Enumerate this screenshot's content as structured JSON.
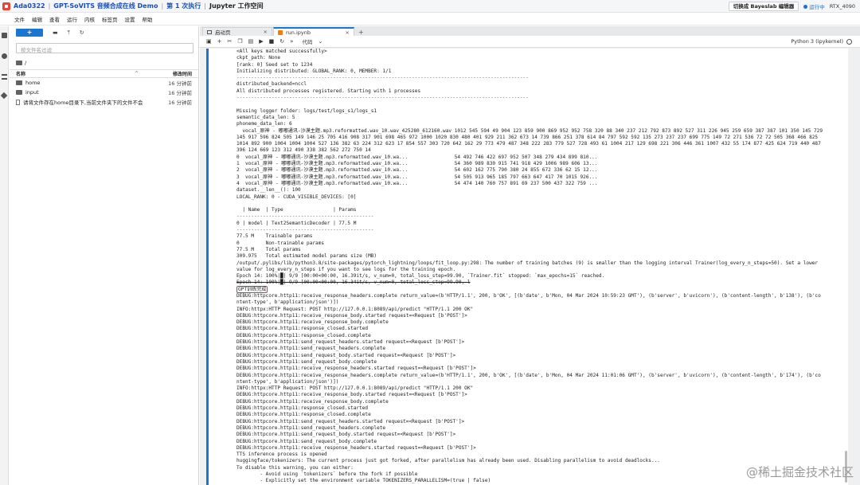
{
  "topbar": {
    "crumbs": [
      "Ada0322",
      "GPT-SoVITS 音频合成在线 Demo",
      "第 1 次执行",
      "Jupyter 工作空间"
    ],
    "switch_label": "切换成 Bayeslab 编辑器",
    "status": "运行中",
    "gpu": "RTX_4090"
  },
  "menu": [
    "文件",
    "编辑",
    "查看",
    "运行",
    "内核",
    "标签页",
    "设置",
    "帮助"
  ],
  "filebrowser": {
    "new_label": "+",
    "filter_placeholder": "按文件名过滤",
    "cwd": "/",
    "col_name": "名称",
    "col_modified": "修改时间",
    "files": [
      {
        "name": "home",
        "time": "16 分钟前",
        "type": "folder"
      },
      {
        "name": "input",
        "time": "16 分钟前",
        "type": "folder"
      },
      {
        "name": "请将文件存在home目录下,当前文件夹下的文件不会...",
        "time": "16 分钟前",
        "type": "file"
      }
    ]
  },
  "tabs": [
    {
      "label": "启动页"
    },
    {
      "label": "run.ipynb"
    }
  ],
  "notebook": {
    "cell_type": "代码",
    "kernel": "Python 3 (ipykernel)"
  },
  "log_lines": [
    {
      "t": "<All keys matched successfully>"
    },
    {
      "t": "ckpt_path: None"
    },
    {
      "t": "[rank: 0] Seed set to 1234"
    },
    {
      "t": "Initializing distributed: GLOBAL_RANK: 0, MEMBER: 1/1"
    },
    {
      "t": "----------------------------------------------------------------------------------------------------",
      "c": "rule"
    },
    {
      "t": "distributed_backend=nccl"
    },
    {
      "t": "All distributed processes registered. Starting with 1 processes"
    },
    {
      "t": "----------------------------------------------------------------------------------------------------",
      "c": "rule"
    },
    {
      "t": ""
    },
    {
      "t": "Missing logger folder: logs/test/logs_s1/logs_s1"
    },
    {
      "t": "semantic_data_len: 5"
    },
    {
      "t": "phoneme_data_len: 6"
    },
    {
      "t": "  vocal_原神 - 嘟嘟通讯-沙漠主题.mp3.reformatted.wav_10.wav_425280_612160.wav 1012 545 594 49 904 123 859 900 869 952 952 758 320 88 340 237 212 792 873 892 527 311 226 945 259 659 387 387 101 350 145 729"
    },
    {
      "t": "145 917 596 824 505 149 146 25 705 416 908 317 901 698 465 972 1000 1020 830 480 401 929 211 362 673 14 739 866 251 378 614 84 797 592 592 135 273 237 237 699 775 149 72 271 536 72 72 505 368 466 825"
    },
    {
      "t": "1014 892 900 1004 1004 1004 527 136 382 63 224 312 623 17 854 557 303 720 642 162 29 773 479 487 348 222 283 779 527 728 493 61 1004 217 129 698 221 306 446 361 1007 432 55 174 877 425 624 719 440 487"
    },
    {
      "t": "396 124 669 123 312 490 338 382 562 272 750 14"
    },
    {
      "t": "0  vocal_原神 - 嘟嘟通讯-沙漠主题.mp3.reformatted.wav_10.wa...                54 492 746 422 697 952 507 348 279 434 899 810..."
    },
    {
      "t": "1  vocal_原神 - 嘟嘟通讯-沙漠主题.mp3.reformatted.wav_10.wa...                54 360 989 830 915 741 918 429 1006 989 606 13..."
    },
    {
      "t": "2  vocal_原神 - 嘟嘟通讯-沙漠主题.mp3.reformatted.wav_10.wa...                54 602 162 775 790 380 24 855 672 336 62 15 12..."
    },
    {
      "t": "3  vocal_原神 - 嘟嘟通讯-沙漠主题.mp3.reformatted.wav_10.wa...                54 505 913 965 185 797 663 647 417 70 1015 926..."
    },
    {
      "t": "4  vocal_原神 - 嘟嘟通讯-沙漠主题.mp3.reformatted.wav_10.wa...                54 474 140 760 757 891 69 237 500 437 322 759 ..."
    },
    {
      "t": "dataset.__len__(): 100"
    },
    {
      "t": "LOCAL_RANK: 0 - CUDA_VISIBLE_DEVICES: [0]"
    },
    {
      "t": ""
    },
    {
      "t": "  | Name  | Type                 | Params"
    },
    {
      "t": "-----------------------------------------------",
      "c": "rule"
    },
    {
      "t": "0 | model | Text2SemanticDecoder | 77.5 M"
    },
    {
      "t": "-----------------------------------------------",
      "c": "rule"
    },
    {
      "t": "77.5 M    Trainable params"
    },
    {
      "t": "0         Non-trainable params"
    },
    {
      "t": "77.5 M    Total params"
    },
    {
      "t": "309.975   Total estimated model params size (MB)"
    },
    {
      "t": "/output/.pylibs/lib/python3.8/site-packages/pytorch_lightning/loops/fit_loop.py:298: The number of training batches (9) is smaller than the logging interval Trainer(log_every_n_steps=50). Set a lower"
    },
    {
      "t": "value for log_every_n_steps if you want to see logs for the training epoch."
    },
    {
      "t": "Epoch 14: 100%|█| 9/9 [00:00<00:00, 16.39it/s, v_num=0, total_loss_step=99.90, `Trainer.fit` stopped: `max_epochs=15` reached."
    },
    {
      "t": "Epoch 14: 100%|█| 9/9 [00:00<00:00, 16.34it/s, v_num=0, total_loss_step=99.90, l",
      "c": "strike"
    },
    {
      "t": "GPT训练完成",
      "c": "hl"
    },
    {
      "t": "DEBUG:httpcore.http11:receive_response_headers.complete return_value=(b'HTTP/1.1', 200, b'OK', [(b'date', b'Mon, 04 Mar 2024 10:59:23 GMT'), (b'server', b'uvicorn'), (b'content-length', b'138'), (b'co"
    },
    {
      "t": "ntent-type', b'application/json')])"
    },
    {
      "t": "INFO:httpx:HTTP Request: POST http://127.0.0.1:8089/api/predict \"HTTP/1.1 200 OK\""
    },
    {
      "t": "DEBUG:httpcore.http11:receive_response_body.started request=<Request [b'POST']>"
    },
    {
      "t": "DEBUG:httpcore.http11:receive_response_body.complete"
    },
    {
      "t": "DEBUG:httpcore.http11:response_closed.started"
    },
    {
      "t": "DEBUG:httpcore.http11:response_closed.complete"
    },
    {
      "t": "DEBUG:httpcore.http11:send_request_headers.started request=<Request [b'POST']>"
    },
    {
      "t": "DEBUG:httpcore.http11:send_request_headers.complete"
    },
    {
      "t": "DEBUG:httpcore.http11:send_request_body.started request=<Request [b'POST']>"
    },
    {
      "t": "DEBUG:httpcore.http11:send_request_body.complete"
    },
    {
      "t": "DEBUG:httpcore.http11:receive_response_headers.started request=<Request [b'POST']>"
    },
    {
      "t": "DEBUG:httpcore.http11:receive_response_headers.complete return_value=(b'HTTP/1.1', 200, b'OK', [(b'date', b'Mon, 04 Mar 2024 11:01:06 GMT'), (b'server', b'uvicorn'), (b'content-length', b'174'), (b'co"
    },
    {
      "t": "ntent-type', b'application/json')])"
    },
    {
      "t": "INFO:httpx:HTTP Request: POST http://127.0.0.1:8089/api/predict \"HTTP/1.1 200 OK\""
    },
    {
      "t": "DEBUG:httpcore.http11:receive_response_body.started request=<Request [b'POST']>"
    },
    {
      "t": "DEBUG:httpcore.http11:receive_response_body.complete"
    },
    {
      "t": "DEBUG:httpcore.http11:response_closed.started"
    },
    {
      "t": "DEBUG:httpcore.http11:response_closed.complete"
    },
    {
      "t": "DEBUG:httpcore.http11:send_request_headers.started request=<Request [b'POST']>"
    },
    {
      "t": "DEBUG:httpcore.http11:send_request_headers.complete"
    },
    {
      "t": "DEBUG:httpcore.http11:send_request_body.started request=<Request [b'POST']>"
    },
    {
      "t": "DEBUG:httpcore.http11:send_request_body.complete"
    },
    {
      "t": "DEBUG:httpcore.http11:receive_response_headers.started request=<Request [b'POST']>"
    },
    {
      "t": "TTS inference process is opened"
    },
    {
      "t": "huggingface/tokenizers: The current process just got forked, after parallelism has already been used. Disabling parallelism to avoid deadlocks..."
    },
    {
      "t": "To disable this warning, you can either:"
    },
    {
      "t": "        - Avoid using `tokenizers` before the fork if possible"
    },
    {
      "t": "        - Explicitly set the environment variable TOKENIZERS_PARALLELISM=(true | false)"
    }
  ],
  "watermark": "@稀土掘金技术社区"
}
